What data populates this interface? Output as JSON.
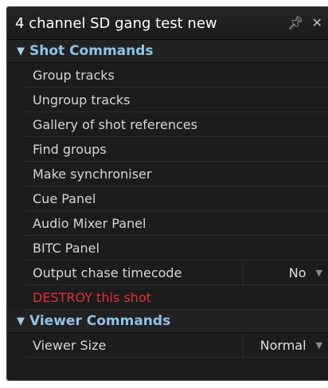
{
  "window": {
    "title": "4 channel SD gang test new",
    "pin_icon": "pin-icon",
    "close_icon": "close-icon"
  },
  "sections": {
    "shot": {
      "title": "Shot Commands",
      "items": [
        {
          "label": "Group tracks"
        },
        {
          "label": "Ungroup tracks"
        },
        {
          "label": "Gallery of shot references"
        },
        {
          "label": "Find groups"
        },
        {
          "label": "Make synchroniser"
        },
        {
          "label": "Cue Panel"
        },
        {
          "label": "Audio Mixer Panel"
        },
        {
          "label": "BITC Panel"
        },
        {
          "label": "Output chase timecode",
          "value": "No"
        },
        {
          "label": "DESTROY this shot",
          "color": "#e53030"
        }
      ]
    },
    "viewer": {
      "title": "Viewer Commands",
      "items": [
        {
          "label": "Viewer Size",
          "value": "Normal"
        }
      ]
    }
  },
  "colors": {
    "section_header": "#8fc3e8",
    "danger": "#e53030",
    "panel_bg": "#1c1c1c"
  }
}
